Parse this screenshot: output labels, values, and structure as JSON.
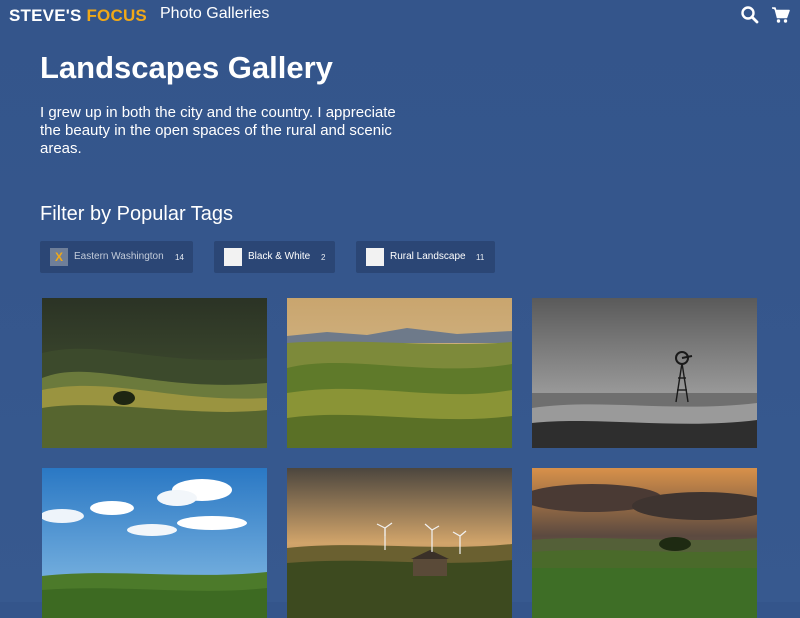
{
  "header": {
    "logo_part1": "STEVE'S",
    "logo_part2": "FOCUS",
    "nav_link": "Photo Galleries",
    "search_icon": "search-icon",
    "cart_icon": "cart-icon"
  },
  "page": {
    "title": "Landscapes Gallery",
    "intro": "I grew up in both the city and the country. I appreciate the beauty in the open spaces of the rural and scenic areas.",
    "filter_heading": "Filter by Popular Tags"
  },
  "tags": [
    {
      "label": "Eastern Washington",
      "count": "14",
      "checked": true,
      "check_mark": "X"
    },
    {
      "label": "Black & White",
      "count": "2",
      "checked": false
    },
    {
      "label": "Rural Landscape",
      "count": "11",
      "checked": false
    }
  ],
  "colors": {
    "accent": "#f0a818",
    "background": "#35568c",
    "tag_bg": "#2b4675"
  }
}
